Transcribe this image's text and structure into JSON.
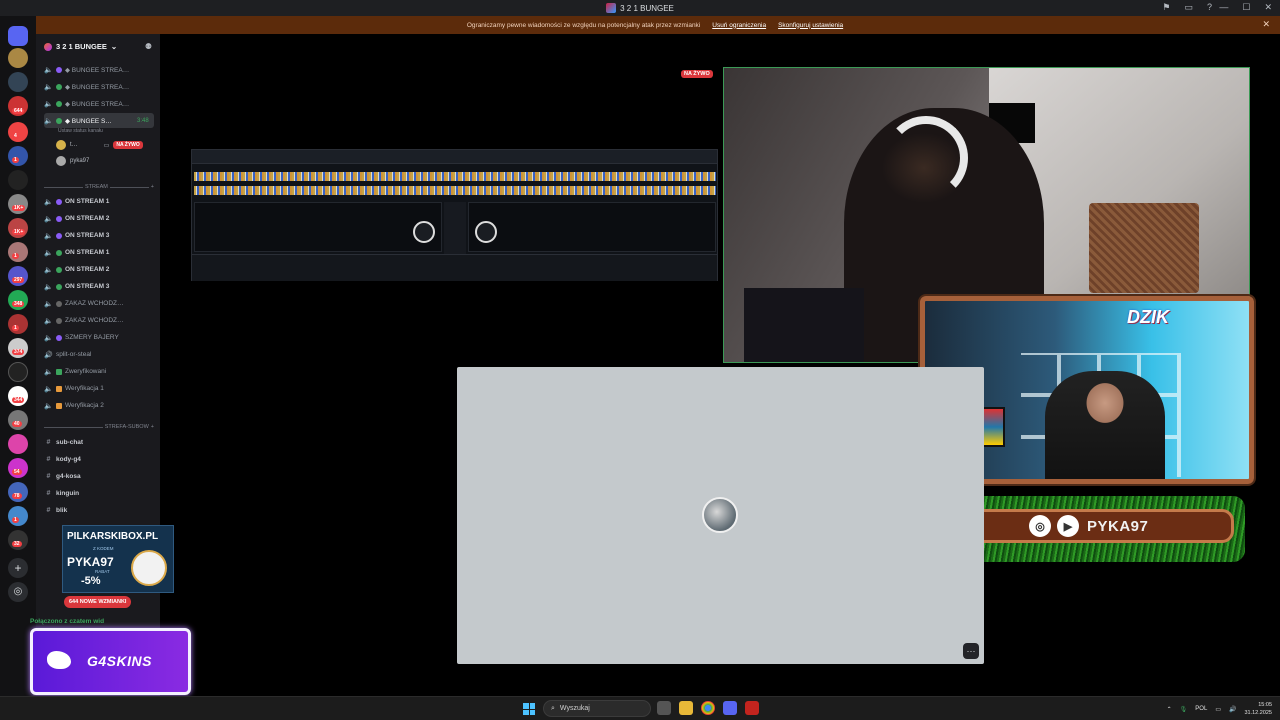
{
  "window": {
    "title": "3 2 1 BUNGEE",
    "controls": [
      "—",
      "☐",
      "✕"
    ],
    "toolbar_icons": [
      "pin-icon",
      "inbox-icon",
      "help-icon"
    ]
  },
  "notice": {
    "text": "Ograniczamy pewne wiadomości ze względu na potencjalny atak przez wzmianki",
    "action1": "Usuń ograniczenia",
    "action2": "Skonfiguruj ustawienia",
    "close": "✕"
  },
  "rail_badges": [
    "644",
    "4",
    "1",
    "1K+",
    "1K+",
    "1",
    "297",
    "348",
    "1",
    "374",
    "344",
    "40",
    "54",
    "78",
    "1",
    "32"
  ],
  "server": {
    "name": "3 2 1 BUNGEE",
    "status_line": "Ustaw status kanału"
  },
  "channels_top": [
    {
      "label": "◆ BUNGEE STREA…"
    },
    {
      "label": "◆ BUNGEE STREA…"
    },
    {
      "label": "◆ BUNGEE STREA…"
    },
    {
      "label": "◆ BUNGEE S…",
      "time": "3:48"
    }
  ],
  "voice_users": [
    {
      "name": "t…",
      "badge": "NA ŻYWO"
    },
    {
      "name": "pyka97"
    }
  ],
  "category_stream": "STREAM",
  "channels_stream": [
    {
      "label": "ON STREAM 1"
    },
    {
      "label": "ON STREAM 2"
    },
    {
      "label": "ON STREAM 3"
    },
    {
      "label": "ON STREAM 1"
    },
    {
      "label": "ON STREAM 2"
    },
    {
      "label": "ON STREAM 3"
    },
    {
      "label": "ZAKAZ WCHODZ…"
    },
    {
      "label": "ZAKAZ WCHODZ…"
    },
    {
      "label": "SZMERY BAJERY"
    },
    {
      "label": "split-or-steal"
    },
    {
      "label": "Zweryfikowani"
    },
    {
      "label": "Weryfikacja 1"
    },
    {
      "label": "Weryfikacja 2"
    }
  ],
  "category_subow": "STREFA-SUBOW",
  "channels_text": [
    {
      "label": "sub-chat"
    },
    {
      "label": "kody-g4"
    },
    {
      "label": "g4-kosa"
    },
    {
      "label": "kinguin"
    },
    {
      "label": "blik"
    }
  ],
  "mentions_pill": "644 NOWE WZMIANKI",
  "connection": "Połączono z czatem wid",
  "ad_pilkarskibox": {
    "site": "PILKARSKIBOX.PL",
    "with_code": "Z KODEM",
    "code": "PYKA97",
    "rabat": "RABAT",
    "discount": "-5%"
  },
  "ad_g4skins": {
    "text": "G4SKINS"
  },
  "stream": {
    "live_tag": "NA ŻYWO"
  },
  "overlay": {
    "cam_logo": "DZIK",
    "social_handle": "PYKA97"
  },
  "tile": {
    "more": "···"
  },
  "taskbar": {
    "search_placeholder": "Wyszukaj",
    "lang": "POL",
    "time": "15:05",
    "date": "31.12.2025"
  },
  "colors": {
    "accent_live": "#da373c",
    "notice_bg": "#5c2b0b",
    "tile_bg": "#c4c9cc",
    "connected": "#3ba55d"
  }
}
